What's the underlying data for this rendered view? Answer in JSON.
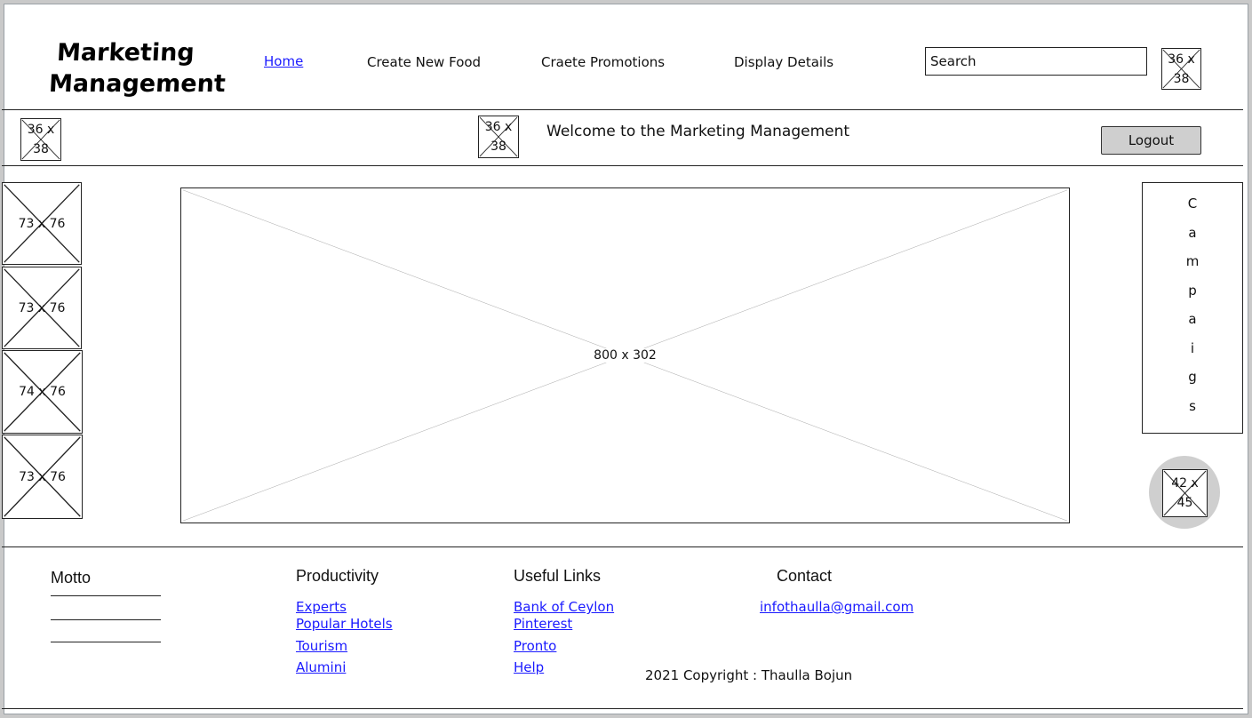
{
  "brand": {
    "line1": "Marketing",
    "line2": "Management"
  },
  "nav": {
    "home": "Home",
    "create_food": "Create New Food",
    "create_promotions": "Craete Promotions",
    "display_details": "Display Details"
  },
  "search": {
    "placeholder": "Search"
  },
  "header_icon": {
    "label": "36 x 38"
  },
  "welcome_bar": {
    "left_icon": "36 x 38",
    "center_icon": "36 x 38",
    "message": "Welcome to the Marketing Management",
    "logout_label": "Logout"
  },
  "side_thumbnails": [
    "73 x 76",
    "73 x 76",
    "74 x 76",
    "73 x 76"
  ],
  "hero": {
    "label": "800 x 302"
  },
  "campaigns": {
    "letters": [
      "C",
      "a",
      "m",
      "p",
      "a",
      "i",
      "g",
      "s"
    ]
  },
  "round_icon": {
    "label": "42 x 45"
  },
  "footer": {
    "motto_title": "Motto",
    "productivity_title": "Productivity",
    "productivity_links": [
      "Experts",
      "Popular Hotels",
      "Tourism",
      "Alumini"
    ],
    "useful_title": "Useful Links",
    "useful_links": [
      "Bank of Ceylon",
      "Pinterest",
      "Pronto",
      "Help"
    ],
    "contact_title": "Contact",
    "contact_email": "infothaulla@gmail.com",
    "copyright": "2021 Copyright : Thaulla Bojun"
  },
  "colors": {
    "link": "#1a1aff",
    "button_bg": "#cfcfcf",
    "circle_bg": "#cfcfcf"
  }
}
